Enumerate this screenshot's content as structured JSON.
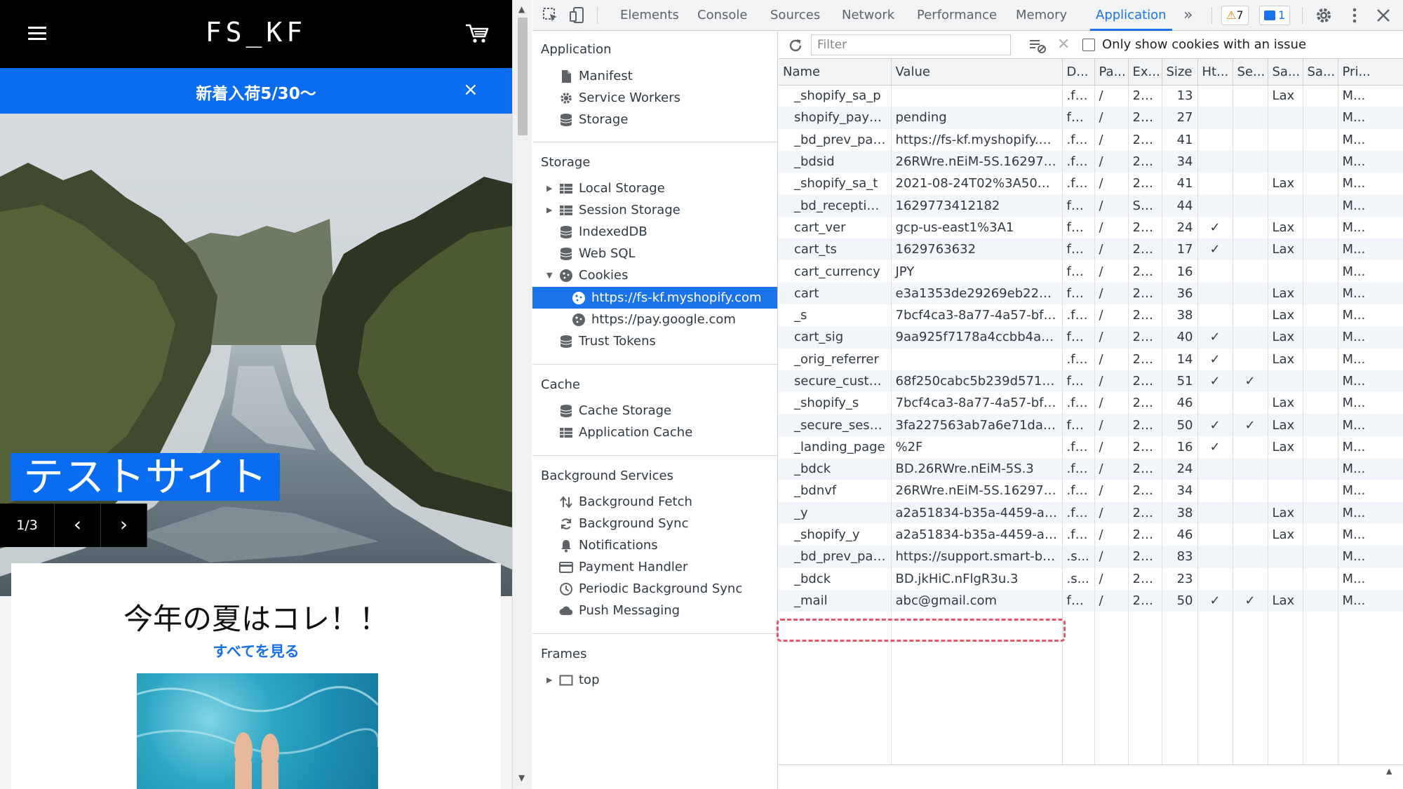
{
  "site": {
    "logo": "FS_KF",
    "announcement": "新着入荷5/30〜",
    "announcement_close": "×",
    "hero_title": "テストサイト",
    "slider_count": "1/3",
    "slider_prev": "‹",
    "slider_next": "›",
    "feature_title": "今年の夏はコレ！！",
    "feature_link": "すべてを見る"
  },
  "devtools": {
    "tabs": [
      "Elements",
      "Console",
      "Sources",
      "Network",
      "Performance",
      "Memory",
      "Application"
    ],
    "active_tab": "Application",
    "more_tabs": "»",
    "warnings_count": "7",
    "messages_count": "1",
    "sidebar": {
      "application_title": "Application",
      "application_items": [
        "Manifest",
        "Service Workers",
        "Storage"
      ],
      "storage_title": "Storage",
      "storage_items": [
        "Local Storage",
        "Session Storage",
        "IndexedDB",
        "Web SQL",
        "Cookies"
      ],
      "cookie_origins": [
        "https://fs-kf.myshopify.com",
        "https://pay.google.com"
      ],
      "trust_tokens": "Trust Tokens",
      "cache_title": "Cache",
      "cache_items": [
        "Cache Storage",
        "Application Cache"
      ],
      "bg_title": "Background Services",
      "bg_items": [
        "Background Fetch",
        "Background Sync",
        "Notifications",
        "Payment Handler",
        "Periodic Background Sync",
        "Push Messaging"
      ],
      "frames_title": "Frames",
      "frames_items": [
        "top"
      ]
    },
    "cookies": {
      "filter_placeholder": "Filter",
      "issue_only_label": "Only show cookies with an issue",
      "columns": [
        "Name",
        "Value",
        "D...",
        "Pa...",
        "Ex...",
        "Size",
        "Ht...",
        "Se...",
        "Sa...",
        "Sa...",
        "Pri..."
      ],
      "rows": [
        [
          "_shopify_sa_p",
          "",
          ".fs-...",
          "/",
          "20...",
          "13",
          "",
          "",
          "Lax",
          "",
          "M..."
        ],
        [
          "shopify_pay_re...",
          "pending",
          "fs-...",
          "/",
          "20...",
          "27",
          "",
          "",
          "",
          "",
          "M..."
        ],
        [
          "_bd_prev_page",
          "https://fs-kf.myshopify.co...",
          ".fs...",
          "/",
          "20...",
          "41",
          "",
          "",
          "",
          "",
          "M..."
        ],
        [
          "_bdsid",
          "26RWre.nEiM-5S.1629772...",
          ".fs...",
          "/",
          "20...",
          "34",
          "",
          "",
          "",
          "",
          "M..."
        ],
        [
          "_shopify_sa_t",
          "2021-08-24T02%3A50%3...",
          ".fs-...",
          "/",
          "20...",
          "41",
          "",
          "",
          "Lax",
          "",
          "M..."
        ],
        [
          "_bd_reception_...",
          "1629773412182",
          "fs-...",
          "/",
          "Se...",
          "44",
          "",
          "",
          "",
          "",
          "M..."
        ],
        [
          "cart_ver",
          "gcp-us-east1%3A1",
          "fs-...",
          "/",
          "20...",
          "24",
          "✓",
          "",
          "Lax",
          "",
          "M..."
        ],
        [
          "cart_ts",
          "1629763632",
          "fs-...",
          "/",
          "20...",
          "17",
          "✓",
          "",
          "Lax",
          "",
          "M..."
        ],
        [
          "cart_currency",
          "JPY",
          "fs-...",
          "/",
          "20...",
          "16",
          "",
          "",
          "",
          "",
          "M..."
        ],
        [
          "cart",
          "e3a1353de29269eb2285d...",
          "fs-...",
          "/",
          "20...",
          "36",
          "",
          "",
          "Lax",
          "",
          "M..."
        ],
        [
          "_s",
          "7bcf4ca3-8a77-4a57-bfd6...",
          ".fs...",
          "/",
          "20...",
          "38",
          "",
          "",
          "Lax",
          "",
          "M..."
        ],
        [
          "cart_sig",
          "9aa925f7178a4ccbb4afa7...",
          "fs-...",
          "/",
          "20...",
          "40",
          "✓",
          "",
          "Lax",
          "",
          "M..."
        ],
        [
          "_orig_referrer",
          "",
          ".fs...",
          "/",
          "20...",
          "14",
          "✓",
          "",
          "Lax",
          "",
          "M..."
        ],
        [
          "secure_custom...",
          "68f250cabc5b239d57107...",
          "fs-...",
          "/",
          "20...",
          "51",
          "✓",
          "✓",
          "",
          "",
          "M..."
        ],
        [
          "_shopify_s",
          "7bcf4ca3-8a77-4a57-bfd6...",
          ".fs...",
          "/",
          "20...",
          "46",
          "",
          "",
          "Lax",
          "",
          "M..."
        ],
        [
          "_secure_session...",
          "3fa227563ab7a6e71daed...",
          "fs-...",
          "/",
          "20...",
          "50",
          "✓",
          "✓",
          "Lax",
          "",
          "M..."
        ],
        [
          "_landing_page",
          "%2F",
          ".fs...",
          "/",
          "20...",
          "16",
          "✓",
          "",
          "Lax",
          "",
          "M..."
        ],
        [
          "_bdck",
          "BD.26RWre.nEiM-5S.3",
          ".fs...",
          "/",
          "20...",
          "24",
          "",
          "",
          "",
          "",
          "M..."
        ],
        [
          "_bdnvf",
          "26RWre.nEiM-5S.1629772...",
          ".fs...",
          "/",
          "20...",
          "34",
          "",
          "",
          "",
          "",
          "M..."
        ],
        [
          "_y",
          "a2a51834-b35a-4459-a03...",
          ".fs...",
          "/",
          "20...",
          "38",
          "",
          "",
          "Lax",
          "",
          "M..."
        ],
        [
          "_shopify_y",
          "a2a51834-b35a-4459-a03...",
          ".fs...",
          "/",
          "20...",
          "46",
          "",
          "",
          "Lax",
          "",
          "M..."
        ],
        [
          "_bd_prev_page",
          "https://support.smart-bda...",
          ".s...",
          "/",
          "20...",
          "83",
          "",
          "",
          "",
          "",
          "M..."
        ],
        [
          "_bdck",
          "BD.jkHiC.nFlgR3u.3",
          ".s...",
          "/",
          "20...",
          "23",
          "",
          "",
          "",
          "",
          "M..."
        ],
        [
          "_mail",
          "abc@gmail.com",
          "fs-...",
          "/",
          "20...",
          "50",
          "✓",
          "✓",
          "Lax",
          "",
          "M..."
        ]
      ]
    }
  }
}
